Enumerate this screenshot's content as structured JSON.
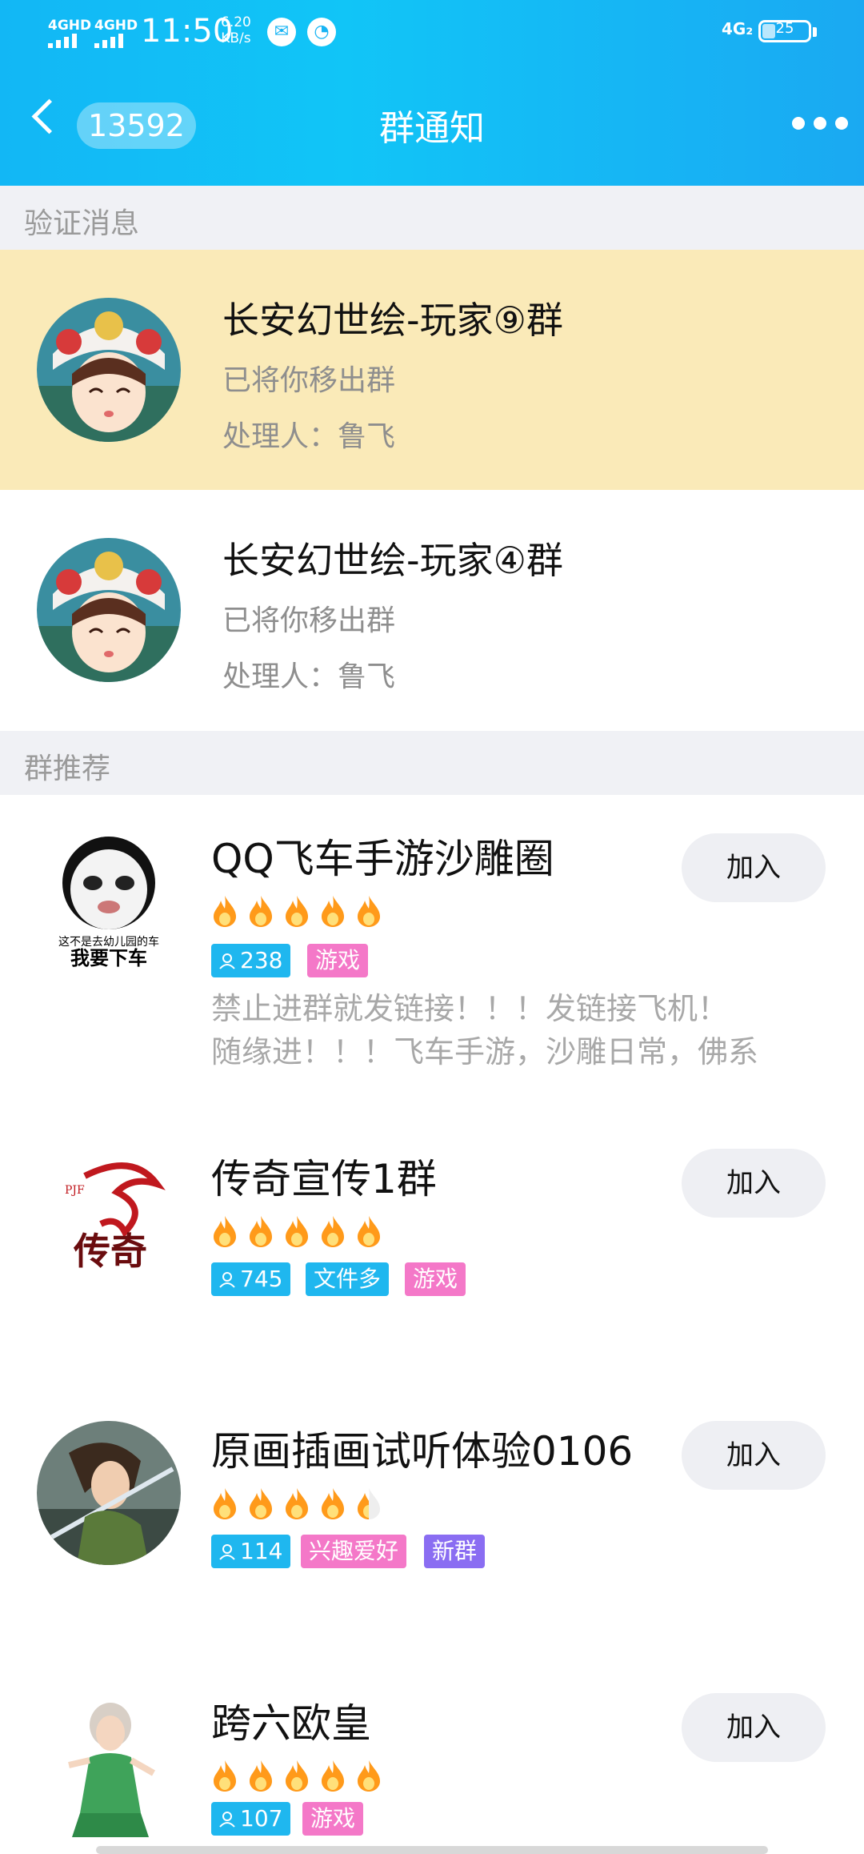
{
  "status_bar": {
    "sim1": "4GHD",
    "sim2": "4GHD",
    "time": "11:50",
    "speed_value": "6.20",
    "speed_unit": "KB/s",
    "right_network": "4G₂",
    "battery": "25"
  },
  "nav": {
    "unread_count": "13592",
    "title": "群通知"
  },
  "sections": {
    "verify": "验证消息",
    "recommend": "群推荐"
  },
  "notices": [
    {
      "group": "长安幻世绘-玩家⑨群",
      "action": "已将你移出群",
      "handler": "处理人：鲁飞"
    },
    {
      "group": "长安幻世绘-玩家④群",
      "action": "已将你移出群",
      "handler": "处理人：鲁飞"
    }
  ],
  "recommendations": [
    {
      "name": "QQ飞车手游沙雕圈",
      "members": "238",
      "tags": [
        "游戏"
      ],
      "desc_line1": "禁止进群就发链接！！！发链接飞机！",
      "desc_line2": "随缘进！！！飞车手游，沙雕日常，佛系",
      "logo_caption1": "这不是去幼儿园的车",
      "logo_caption2": "我要下车",
      "join": "加入",
      "heat": 5
    },
    {
      "name": "传奇宣传1群",
      "members": "745",
      "tags": [
        "文件多",
        "游戏"
      ],
      "logo_small": "PJF",
      "logo_text": "传奇",
      "join": "加入",
      "heat": 5
    },
    {
      "name": "原画插画试听体验0106",
      "members": "114",
      "tags": [
        "兴趣爱好",
        "新群"
      ],
      "join": "加入",
      "heat": 4.5
    },
    {
      "name": "跨六欧皇",
      "members": "107",
      "tags": [
        "游戏"
      ],
      "join": "加入",
      "heat": 5
    }
  ],
  "colors": {
    "header": "#12b7f5",
    "highlight_row": "#faeab8",
    "tag_blue": "#1fb7ef",
    "tag_pink": "#f478c8",
    "tag_purple": "#8a6df2",
    "flame": "#ff9a1a"
  }
}
